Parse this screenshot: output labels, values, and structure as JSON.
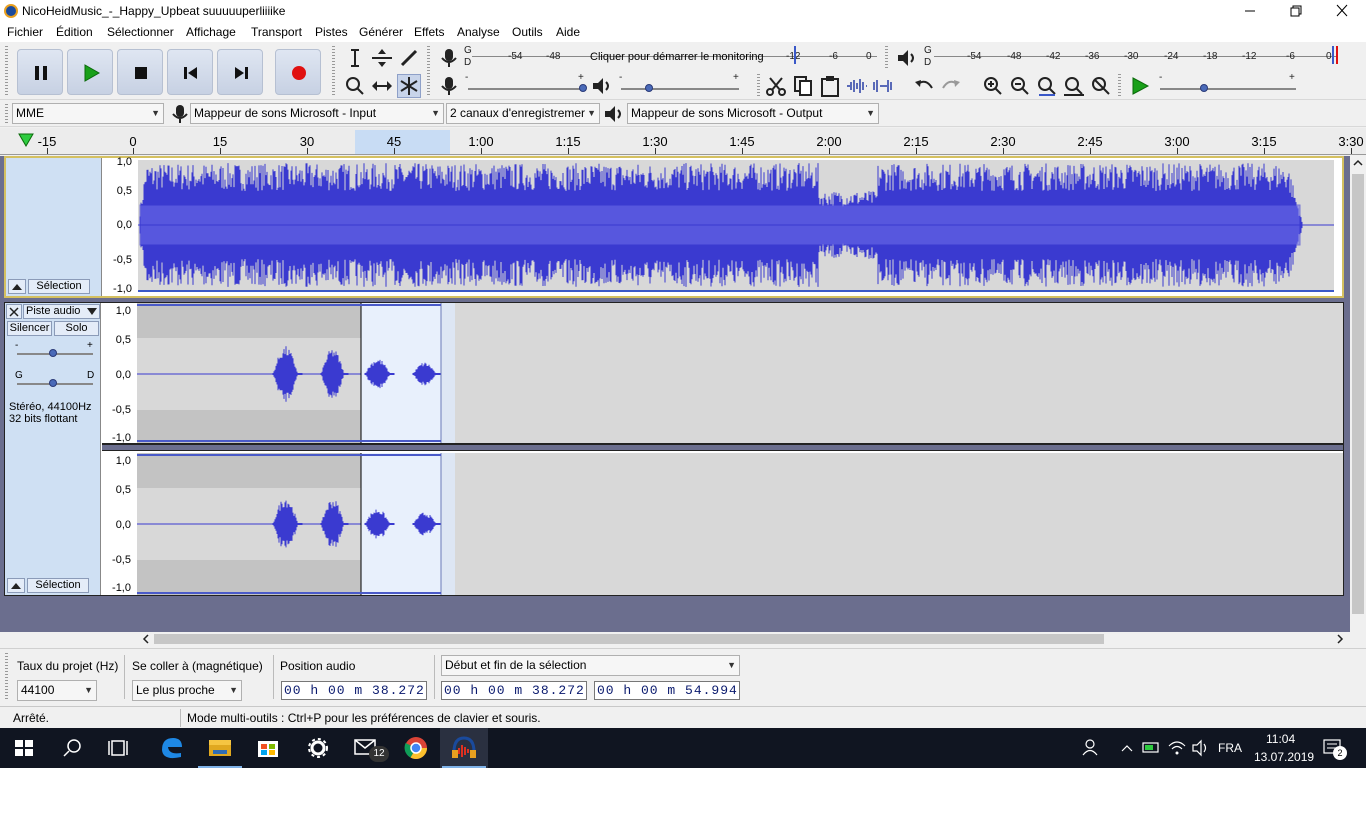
{
  "window": {
    "title": "NicoHeidMusic_-_Happy_Upbeat suuuuuperliiiike",
    "minimize_icon": "minimize-icon",
    "restore_icon": "restore-icon",
    "close_icon": "close-icon"
  },
  "menu": [
    "Fichier",
    "Édition",
    "Sélectionner",
    "Affichage",
    "Transport",
    "Pistes",
    "Générer",
    "Effets",
    "Analyse",
    "Outils",
    "Aide"
  ],
  "meters": {
    "record_scale": [
      "-54",
      "-48",
      "-12",
      "-6",
      "0"
    ],
    "monitor_prompt": "Cliquer pour démarrer le monitoring",
    "record_channel_labels": [
      "G",
      "D"
    ],
    "play_scale": [
      "-54",
      "-48",
      "-42",
      "-36",
      "-30",
      "-24",
      "-18",
      "-12",
      "-6",
      "0"
    ],
    "play_channel_labels": [
      "G",
      "D"
    ],
    "record_slider_minus": "-",
    "record_slider_plus": "+",
    "play_slider_minus": "-",
    "play_slider_plus": "+",
    "speed_slider_minus": "-",
    "speed_slider_plus": "+"
  },
  "device": {
    "host": "MME",
    "input": "Mappeur de sons Microsoft - Input",
    "channels": "2 canaux d'enregistremer",
    "output": "Mappeur de sons Microsoft - Output"
  },
  "ruler": {
    "labels": [
      "-15",
      "0",
      "15",
      "30",
      "45",
      "1:00",
      "1:15",
      "1:30",
      "1:45",
      "2:00",
      "2:15",
      "2:30",
      "2:45",
      "3:00",
      "3:15",
      "3:30"
    ]
  },
  "track1": {
    "scale": [
      "1,0",
      "0,5",
      "0,0",
      "-0,5",
      "-1,0"
    ],
    "select_label": "Sélection"
  },
  "track2": {
    "name": "Piste audio",
    "mute": "Silencer",
    "solo": "Solo",
    "gain_minus": "-",
    "gain_plus": "+",
    "pan_left": "G",
    "pan_right": "D",
    "format_line1": "Stéréo, 44100Hz",
    "format_line2": "32 bits flottant",
    "scale_top": [
      "1,0",
      "0,5",
      "0,0",
      "-0,5",
      "-1,0"
    ],
    "scale_bottom": [
      "1,0",
      "0,5",
      "0,0",
      "-0,5",
      "-1,0"
    ],
    "select_label": "Sélection"
  },
  "selection_toolbar": {
    "rate_label": "Taux du projet (Hz)",
    "rate_value": "44100",
    "snap_label": "Se coller à (magnétique)",
    "snap_value": "Le plus proche",
    "audio_pos_label": "Position audio",
    "audio_pos": "00 h 00 m 38.272 s",
    "selection_mode": "Début et fin de la sélection",
    "sel_start": "00 h 00 m 38.272 s",
    "sel_end": "00 h 00 m 54.994 s"
  },
  "status": {
    "state": "Arrêté.",
    "hint": "Mode multi-outils : Ctrl+P pour les préférences de clavier et souris."
  },
  "taskbar": {
    "mail_badge": "12",
    "language": "FRA",
    "time": "11:04",
    "date": "13.07.2019",
    "notification_count": "2"
  },
  "colors": {
    "waveform": "#3a3ad0",
    "waveform_rms": "#6b6be8",
    "selection_bg": "#e8f0fc",
    "track_panel": "#cfe0f3",
    "record_red": "#e01010",
    "play_green": "#19a019"
  }
}
